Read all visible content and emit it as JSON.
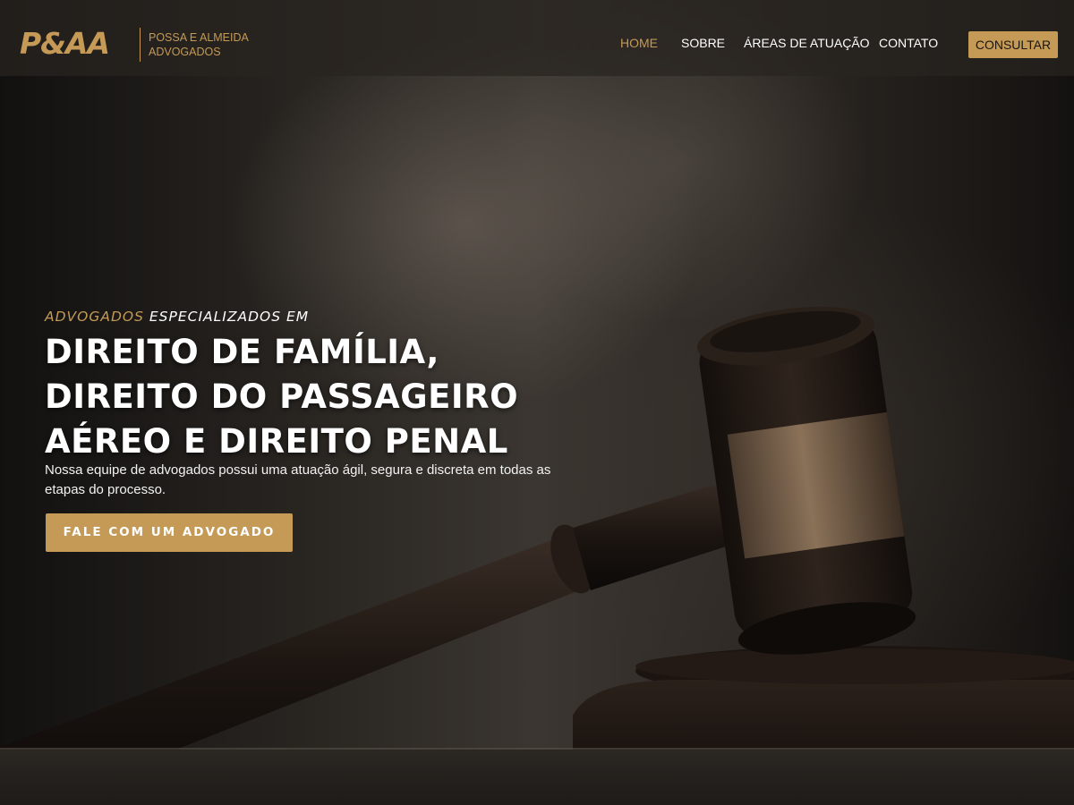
{
  "header": {
    "logo_mark": "P&AA",
    "logo_name": "POSSA E ALMEIDA\nADVOGADOS",
    "nav": [
      {
        "label": "HOME",
        "active": true
      },
      {
        "label": "SOBRE",
        "active": false
      },
      {
        "label": "ÁREAS DE ATUAÇÃO",
        "active": false
      },
      {
        "label": "CONTATO",
        "active": false
      }
    ],
    "consult_label": "CONSULTAR"
  },
  "hero": {
    "eyebrow_accent": "ADVOGADOS",
    "eyebrow_rest": " ESPECIALIZADOS EM",
    "headline": "DIREITO DE FAMÍLIA, DIREITO DO PASSAGEIRO AÉREO E DIREITO PENAL",
    "subtext": "Nossa equipe de advogados possui uma atuação ágil, segura e discreta em todas as etapas do processo.",
    "cta_label": "FALE COM UM ADVOGADO"
  },
  "colors": {
    "accent": "#c49a56",
    "text": "#ffffff",
    "background": "#1a1714"
  },
  "icons": {
    "background_image": "gavel-on-sound-block-photo"
  }
}
